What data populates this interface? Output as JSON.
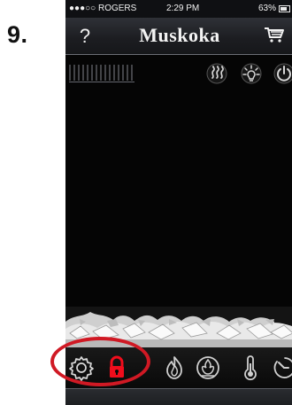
{
  "step": {
    "label": "9."
  },
  "status_bar": {
    "carrier": "●●●○○ ROGERS",
    "time": "2:29 PM",
    "battery": "63%"
  },
  "header": {
    "help_label": "?",
    "logo_text": "Muskoka"
  },
  "icons": {
    "help": "help-icon",
    "cart": "shopping-cart-icon",
    "heat": "heat-icon",
    "light": "light-icon",
    "power": "power-icon",
    "settings": "gear-icon",
    "lock": "lock-icon",
    "flame": "flame-icon",
    "fuel": "fuel-bed-icon",
    "temperature": "thermometer-icon",
    "timer": "timer-icon"
  },
  "colors": {
    "lock_active": "#f10d1c",
    "highlight_ring": "#d01924",
    "icon": "#d8d8d8",
    "background": "#050505"
  }
}
